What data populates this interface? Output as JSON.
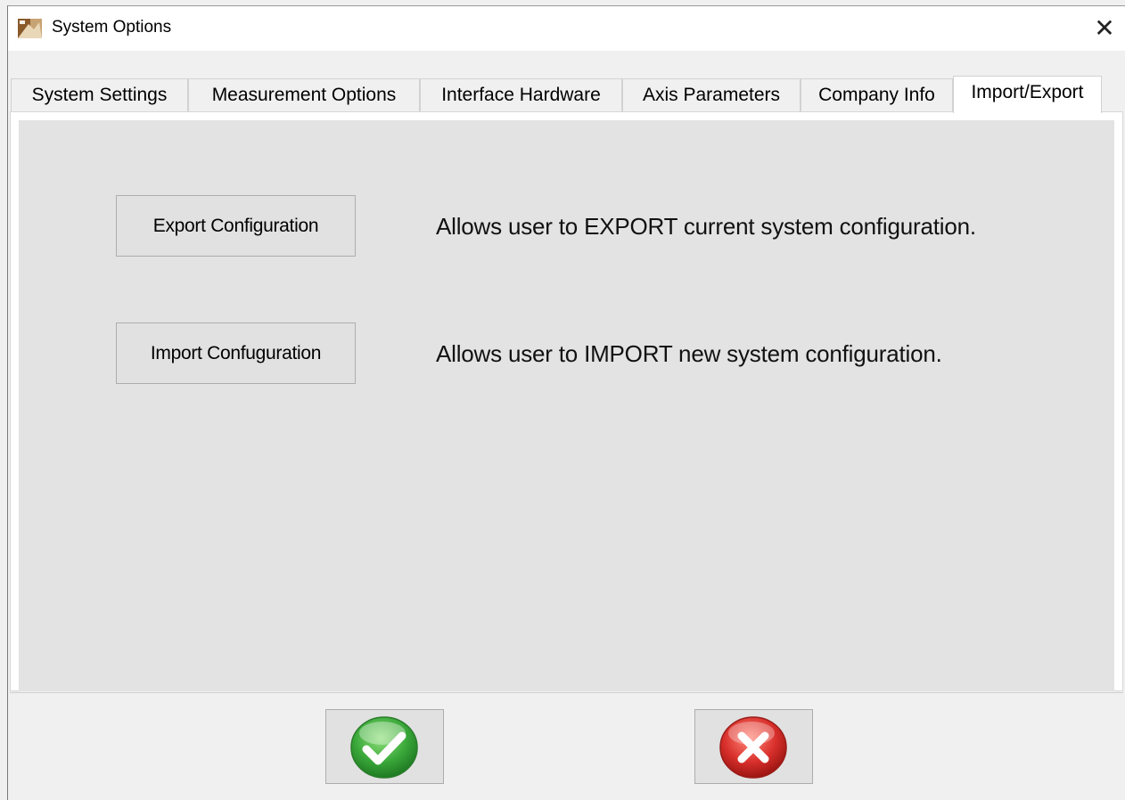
{
  "window": {
    "title": "System Options",
    "close_glyph": "✕"
  },
  "tabs": [
    {
      "label": "System Settings",
      "active": false
    },
    {
      "label": "Measurement Options",
      "active": false
    },
    {
      "label": "Interface Hardware",
      "active": false
    },
    {
      "label": "Axis Parameters",
      "active": false
    },
    {
      "label": "Company Info",
      "active": false
    },
    {
      "label": "Import/Export",
      "active": true
    }
  ],
  "import_export": {
    "export_button": "Export Configuration",
    "export_description": "Allows user to EXPORT current system configuration.",
    "import_button": "Import Confuguration",
    "import_description": "Allows user to IMPORT new system configuration."
  },
  "footer": {
    "ok_icon": "green-checkmark-icon",
    "cancel_icon": "red-x-icon"
  },
  "colors": {
    "ok_green": "#3aa83a",
    "cancel_red": "#d9302c",
    "panel_gray": "#e3e3e3"
  }
}
